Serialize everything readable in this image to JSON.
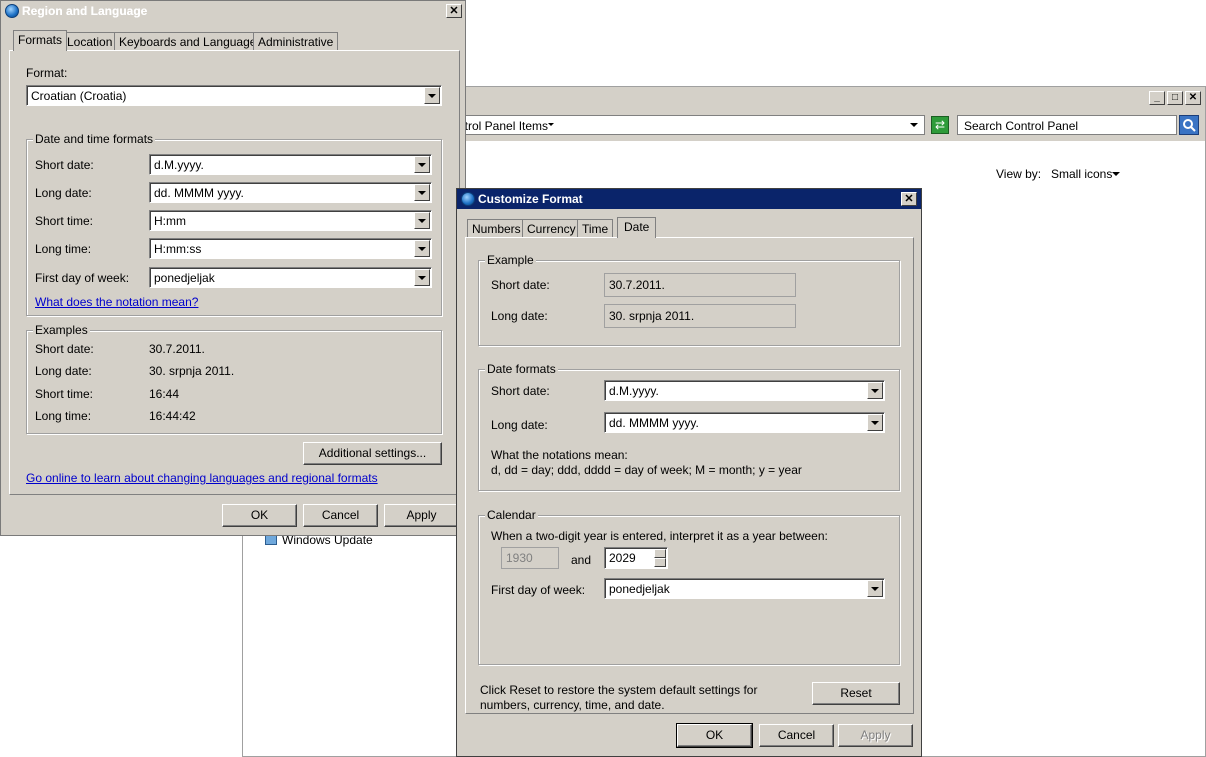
{
  "control_panel": {
    "breadcrumb": "ntrol Panel Items",
    "search_placeholder": "Search Control Panel",
    "view_by_label": "View by:",
    "view_by_value": "Small icons",
    "partial_item": "Windows Update",
    "min": "_",
    "max": "□",
    "close": "✕"
  },
  "region": {
    "title": "Region and Language",
    "close": "✕",
    "tabs": [
      "Formats",
      "Location",
      "Keyboards and Languages",
      "Administrative"
    ],
    "format_label": "Format:",
    "format_value": "Croatian (Croatia)",
    "dt_group": "Date and time formats",
    "rows": [
      {
        "label": "Short date:",
        "value": "d.M.yyyy."
      },
      {
        "label": "Long date:",
        "value": "dd. MMMM yyyy."
      },
      {
        "label": "Short time:",
        "value": "H:mm"
      },
      {
        "label": "Long time:",
        "value": "H:mm:ss"
      },
      {
        "label": "First day of week:",
        "value": "ponedjeljak"
      }
    ],
    "notation_link": "What does the notation mean?",
    "examples_group": "Examples",
    "examples": [
      {
        "label": "Short date:",
        "value": "30.7.2011."
      },
      {
        "label": "Long date:",
        "value": "30. srpnja 2011."
      },
      {
        "label": "Short time:",
        "value": "16:44"
      },
      {
        "label": "Long time:",
        "value": "16:44:42"
      }
    ],
    "additional_btn": "Additional settings...",
    "online_link": "Go online to learn about changing languages and regional formats",
    "ok": "OK",
    "cancel": "Cancel",
    "apply": "Apply"
  },
  "customize": {
    "title": "Customize Format",
    "close": "✕",
    "tabs": [
      "Numbers",
      "Currency",
      "Time",
      "Date"
    ],
    "example_group": "Example",
    "ex_short_label": "Short date:",
    "ex_short_value": "30.7.2011.",
    "ex_long_label": "Long date:",
    "ex_long_value": "30. srpnja 2011.",
    "formats_group": "Date formats",
    "short_label": "Short date:",
    "short_value": "d.M.yyyy.",
    "long_label": "Long date:",
    "long_value": "dd. MMMM yyyy.",
    "notations_title": "What the notations mean:",
    "notations_text": "d, dd = day;  ddd, dddd = day of week;  M = month;  y = year",
    "calendar_group": "Calendar",
    "calendar_text": "When a two-digit year is entered, interpret it as a year between:",
    "year_from": "1930",
    "and": "and",
    "year_to": "2029",
    "first_day_label": "First day of week:",
    "first_day_value": "ponedjeljak",
    "reset_text_1": "Click Reset to restore the system default settings for",
    "reset_text_2": "numbers, currency, time, and date.",
    "reset": "Reset",
    "ok": "OK",
    "cancel": "Cancel",
    "apply": "Apply"
  }
}
